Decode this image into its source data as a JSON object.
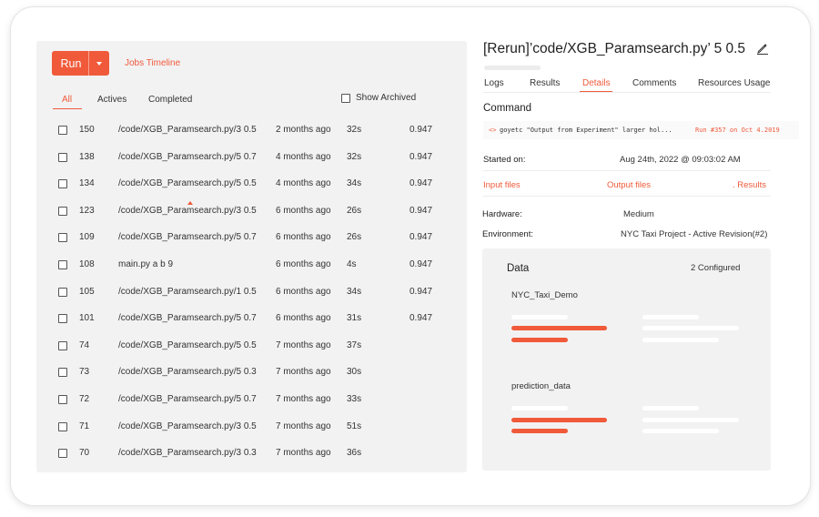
{
  "toolbar": {
    "run_label": "Run",
    "jobs_timeline": "Jobs Timeline"
  },
  "filters": {
    "all": "All",
    "actives": "Actives",
    "completed": "Completed",
    "show_archived": "Show Archived"
  },
  "jobs": [
    {
      "id": "150",
      "name": "/code/XGB_Paramsearch.py/3 0.5",
      "age": "2 months ago",
      "duration": "32s",
      "score": "0.947"
    },
    {
      "id": "138",
      "name": "/code/XGB_Paramsearch.py/5 0.7",
      "age": "4 months ago",
      "duration": "32s",
      "score": "0.947"
    },
    {
      "id": "134",
      "name": "/code/XGB_Paramsearch.py/5 0.5",
      "age": "4 months ago",
      "duration": "34s",
      "score": "0.947"
    },
    {
      "id": "123",
      "name": "/code/XGB_Paramsearch.py/3 0.5",
      "age": "6 months ago",
      "duration": "26s",
      "score": "0.947"
    },
    {
      "id": "109",
      "name": "/code/XGB_Paramsearch.py/5 0.7",
      "age": "6 months ago",
      "duration": "26s",
      "score": "0.947"
    },
    {
      "id": "108",
      "name": "main.py a b 9",
      "age": "6 months ago",
      "duration": "4s",
      "score": "0.947"
    },
    {
      "id": "105",
      "name": "/code/XGB_Paramsearch.py/1 0.5",
      "age": "6 months ago",
      "duration": "34s",
      "score": "0.947"
    },
    {
      "id": "101",
      "name": "/code/XGB_Paramsearch.py/5 0.7",
      "age": "6 months ago",
      "duration": "31s",
      "score": "0.947"
    },
    {
      "id": "74",
      "name": "/code/XGB_Paramsearch.py/5 0.5",
      "age": "7 months ago",
      "duration": "37s",
      "score": ""
    },
    {
      "id": "73",
      "name": "/code/XGB_Paramsearch.py/5 0.3",
      "age": "7 months ago",
      "duration": "30s",
      "score": ""
    },
    {
      "id": "72",
      "name": "/code/XGB_Paramsearch.py/5 0.7",
      "age": "7 months ago",
      "duration": "33s",
      "score": ""
    },
    {
      "id": "71",
      "name": "/code/XGB_Paramsearch.py/3 0.5",
      "age": "7 months ago",
      "duration": "51s",
      "score": ""
    },
    {
      "id": "70",
      "name": "/code/XGB_Paramsearch.py/3 0.3",
      "age": "7 months ago",
      "duration": "36s",
      "score": ""
    }
  ],
  "detail": {
    "title": "[Rerun]’code/XGB_Paramsearch.py’ 5 0.5",
    "tabs": {
      "logs": "Logs",
      "results": "Results",
      "details": "Details",
      "comments": "Comments",
      "resources": "Resources Usage"
    },
    "command_heading": "Command",
    "command_arrow": "<>",
    "command_text": "goyetc \"Output from Experiment\" larger hol...",
    "command_run": "Run #357 on Oct 4.2019",
    "started_label": "Started on:",
    "started_value": "Aug 24th, 2022 @ 09:03:02 AM",
    "input_files": "Input files",
    "output_files": "Output files",
    "results_link": ". Results",
    "hardware_label": "Hardware:",
    "hardware_value": "Medium",
    "environment_label": "Environment:",
    "environment_value": "NYC Taxi Project - Active Revision(#2)"
  },
  "data_section": {
    "title": "Data",
    "count": "2 Configured",
    "datasets": [
      "NYC_Taxi_Demo",
      "prediction_data"
    ]
  },
  "colors": {
    "accent": "#f05a3a",
    "panel": "#f2f2f3"
  }
}
